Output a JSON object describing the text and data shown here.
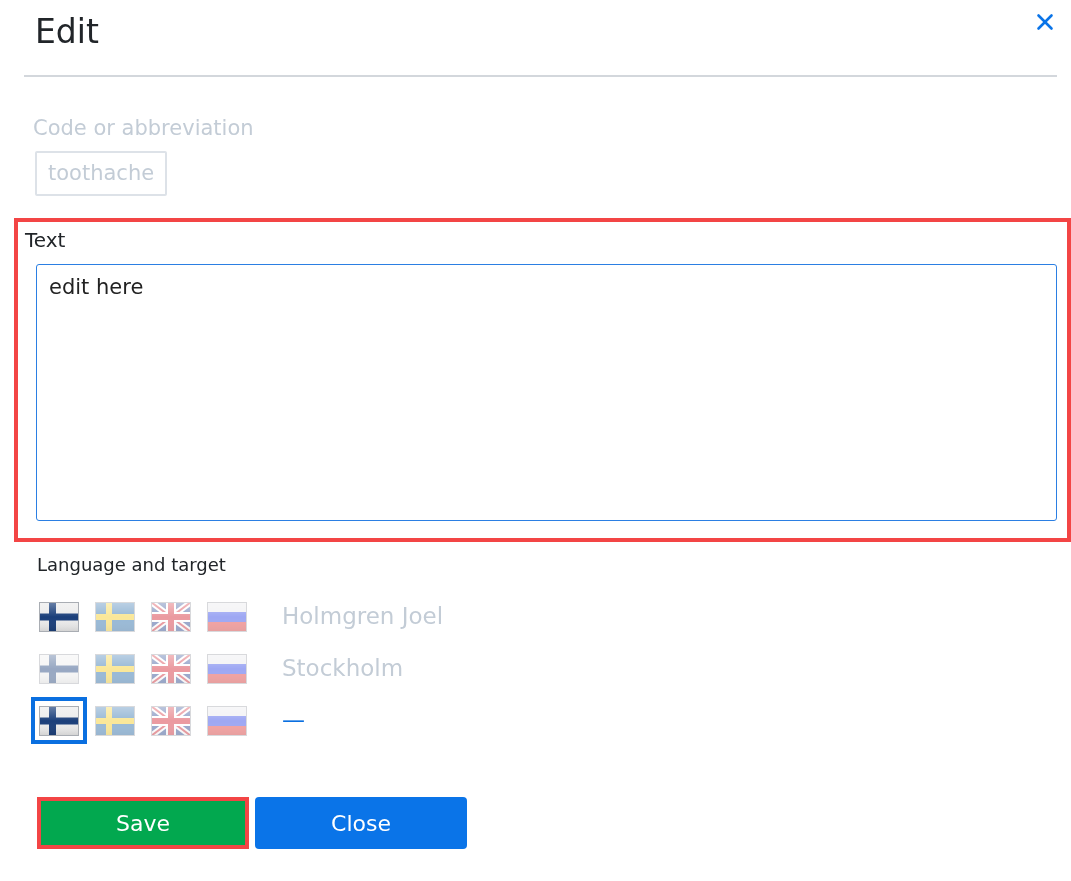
{
  "dialog": {
    "title": "Edit"
  },
  "code_field": {
    "label": "Code or abbreviation",
    "value": "toothache",
    "disabled": true
  },
  "text_field": {
    "label": "Text",
    "value": "edit here",
    "highlighted": true
  },
  "language": {
    "label": "Language and target",
    "rows": [
      {
        "flags": [
          {
            "kind": "fi",
            "selected": true,
            "focused": false
          },
          {
            "kind": "se",
            "selected": false,
            "focused": false
          },
          {
            "kind": "gb",
            "selected": false,
            "focused": false
          },
          {
            "kind": "ru",
            "selected": false,
            "focused": false
          }
        ],
        "target": {
          "kind": "text",
          "text": "Holmgren Joel"
        }
      },
      {
        "flags": [
          {
            "kind": "fi",
            "selected": false,
            "focused": false
          },
          {
            "kind": "se",
            "selected": false,
            "focused": false
          },
          {
            "kind": "gb",
            "selected": false,
            "focused": false
          },
          {
            "kind": "ru",
            "selected": false,
            "focused": false
          }
        ],
        "target": {
          "kind": "text",
          "text": "Stockholm"
        }
      },
      {
        "flags": [
          {
            "kind": "fi",
            "selected": true,
            "focused": true
          },
          {
            "kind": "se",
            "selected": false,
            "focused": false
          },
          {
            "kind": "gb",
            "selected": false,
            "focused": false
          },
          {
            "kind": "ru",
            "selected": false,
            "focused": false
          }
        ],
        "target": {
          "kind": "link",
          "text": "—"
        }
      }
    ]
  },
  "buttons": [
    {
      "label": "Save",
      "kind": "success",
      "highlighted": true
    },
    {
      "label": "Close",
      "kind": "primary",
      "highlighted": false
    }
  ]
}
